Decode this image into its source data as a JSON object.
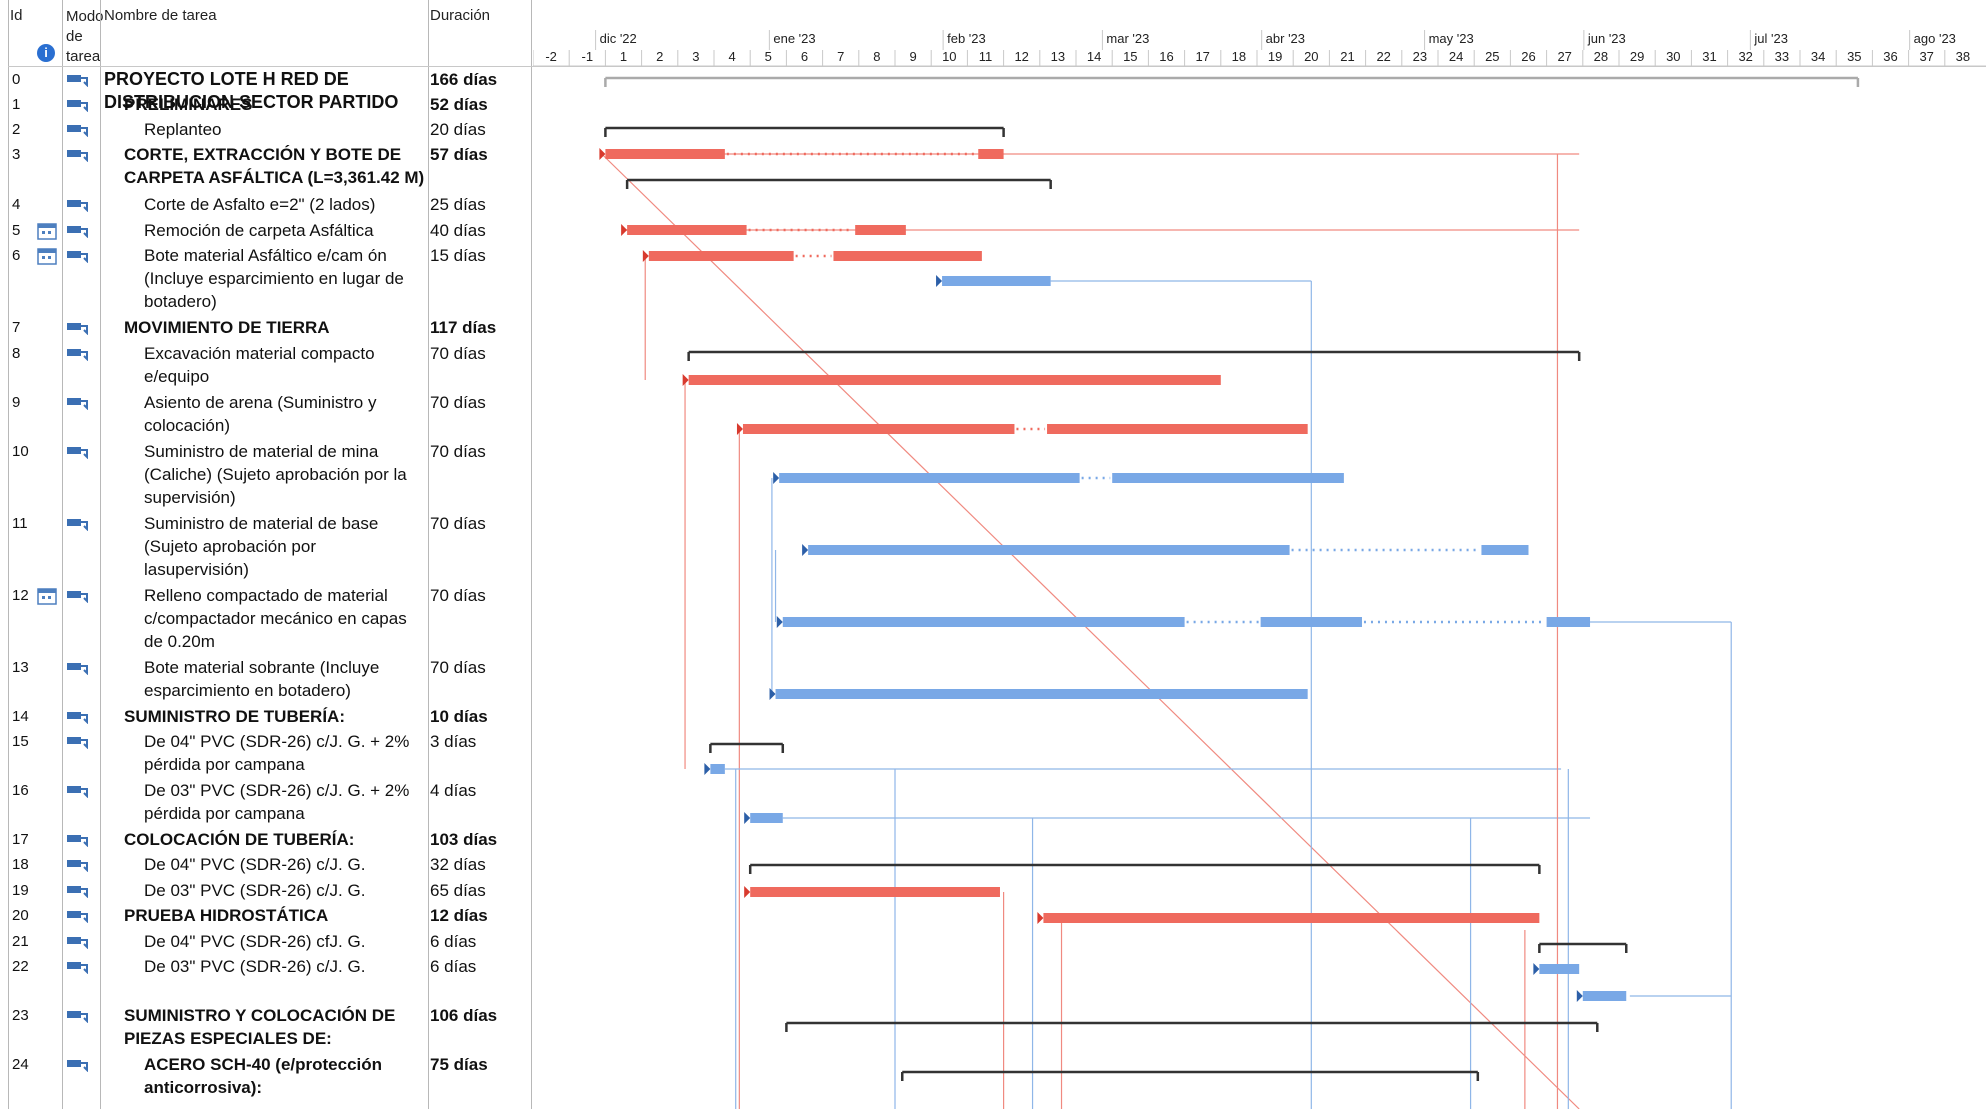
{
  "columns": {
    "id": "Id",
    "mode": "Modo de tarea",
    "name": "Nombre de tarea",
    "duration": "Duración"
  },
  "timescale": {
    "months": [
      "dic '22",
      "ene '23",
      "feb '23",
      "mar '23",
      "abr '23",
      "may '23",
      "jun '23",
      "jul '23",
      "ago '23"
    ],
    "weeks": [
      "-2",
      "-1",
      "1",
      "2",
      "3",
      "4",
      "5",
      "6",
      "7",
      "8",
      "9",
      "10",
      "11",
      "12",
      "13",
      "14",
      "15",
      "16",
      "17",
      "18",
      "19",
      "20",
      "21",
      "22",
      "23",
      "24",
      "25",
      "26",
      "27",
      "28",
      "29",
      "30",
      "31",
      "32",
      "33",
      "34",
      "35",
      "36",
      "37",
      "38"
    ]
  },
  "tasks": [
    {
      "id": "0",
      "name": "PROYECTO LOTE H RED DE DISTRIBUCION SECTOR PARTIDO",
      "duration": "166 días",
      "level": 0,
      "summary": true,
      "calendar": false,
      "segments": [
        [
          1,
          35.6
        ]
      ],
      "critical": false
    },
    {
      "id": "1",
      "name": "PRELIMINARES",
      "duration": "52 días",
      "level": 1,
      "summary": true,
      "calendar": false,
      "segments": [
        [
          1,
          12
        ]
      ],
      "critical": false
    },
    {
      "id": "2",
      "name": "Replanteo",
      "duration": "20 días",
      "level": 2,
      "summary": false,
      "calendar": false,
      "segments": [
        [
          1,
          4.3
        ],
        [
          11.3,
          12
        ]
      ],
      "critical": true
    },
    {
      "id": "3",
      "name": "CORTE, EXTRACCIÓN Y BOTE DE CARPETA ASFÁLTICA (L=3,361.42 M)",
      "duration": "57 días",
      "level": 1,
      "summary": true,
      "calendar": false,
      "segments": [
        [
          1.6,
          13.3
        ]
      ],
      "critical": false
    },
    {
      "id": "4",
      "name": "Corte de Asfalto e=2\" (2 lados)",
      "duration": "25 días",
      "level": 2,
      "summary": false,
      "calendar": false,
      "segments": [
        [
          1.6,
          4.9
        ],
        [
          7.9,
          9.3
        ]
      ],
      "critical": true
    },
    {
      "id": "5",
      "name": "Remoción de carpeta Asfáltica",
      "duration": "40 días",
      "level": 2,
      "summary": false,
      "calendar": true,
      "segments": [
        [
          2.2,
          6.2
        ],
        [
          7.3,
          11.4
        ]
      ],
      "critical": true
    },
    {
      "id": "6",
      "name": "Bote material Asfáltico e/cam ón (Incluye esparcimiento en lugar de botadero)",
      "duration": "15 días",
      "level": 2,
      "summary": false,
      "calendar": true,
      "segments": [
        [
          10.3,
          13.3
        ]
      ],
      "critical": false
    },
    {
      "id": "7",
      "name": "MOVIMIENTO DE TIERRA",
      "duration": "117 días",
      "level": 1,
      "summary": true,
      "calendar": false,
      "segments": [
        [
          3.3,
          27.9
        ]
      ],
      "critical": false
    },
    {
      "id": "8",
      "name": "Excavación material compacto e/equipo",
      "duration": "70 días",
      "level": 2,
      "summary": false,
      "calendar": false,
      "segments": [
        [
          3.3,
          18
        ]
      ],
      "critical": true
    },
    {
      "id": "9",
      "name": "Asiento de arena (Suministro y colocación)",
      "duration": "70 días",
      "level": 2,
      "summary": false,
      "calendar": false,
      "segments": [
        [
          4.8,
          12.3
        ],
        [
          13.2,
          20.4
        ]
      ],
      "critical": true
    },
    {
      "id": "10",
      "name": "Suministro de material de mina (Caliche) (Sujeto aprobación por la supervisión)",
      "duration": "70 días",
      "level": 2,
      "summary": false,
      "calendar": false,
      "segments": [
        [
          5.8,
          14.1
        ],
        [
          15,
          21.4
        ]
      ],
      "critical": false
    },
    {
      "id": "11",
      "name": "Suministro de material de base (Sujeto aprobación por lasupervisión)",
      "duration": "70 días",
      "level": 2,
      "summary": false,
      "calendar": false,
      "segments": [
        [
          6.6,
          19.9
        ],
        [
          25.2,
          26.5
        ]
      ],
      "critical": false
    },
    {
      "id": "12",
      "name": "Relleno compactado de material c/compactador mecánico en capas de 0.20m",
      "duration": "70 días",
      "level": 2,
      "summary": false,
      "calendar": true,
      "segments": [
        [
          5.9,
          17
        ],
        [
          19.1,
          21.9
        ],
        [
          27,
          28.2
        ]
      ],
      "critical": false
    },
    {
      "id": "13",
      "name": "Bote material sobrante (Incluye esparcimiento en botadero)",
      "duration": "70 días",
      "level": 2,
      "summary": false,
      "calendar": false,
      "segments": [
        [
          5.7,
          20.4
        ]
      ],
      "critical": false
    },
    {
      "id": "14",
      "name": "SUMINISTRO DE TUBERÍA:",
      "duration": "10 días",
      "level": 1,
      "summary": true,
      "calendar": false,
      "segments": [
        [
          3.9,
          5.9
        ]
      ],
      "critical": false
    },
    {
      "id": "15",
      "name": "De 04\" PVC (SDR-26) c/J. G. + 2% pérdida por campana",
      "duration": "3 días",
      "level": 2,
      "summary": false,
      "calendar": false,
      "segments": [
        [
          3.9,
          4.3
        ]
      ],
      "critical": false
    },
    {
      "id": "16",
      "name": "De 03\" PVC (SDR-26) c/J. G. + 2% pérdida por campana",
      "duration": "4 días",
      "level": 2,
      "summary": false,
      "calendar": false,
      "segments": [
        [
          5.0,
          5.9
        ]
      ],
      "critical": false
    },
    {
      "id": "17",
      "name": "COLOCACIÓN DE TUBERÍA:",
      "duration": "103 días",
      "level": 1,
      "summary": true,
      "calendar": false,
      "segments": [
        [
          5.0,
          26.8
        ]
      ],
      "critical": false
    },
    {
      "id": "18",
      "name": "De 04\" PVC (SDR-26) c/J. G.",
      "duration": "32 días",
      "level": 2,
      "summary": false,
      "calendar": false,
      "segments": [
        [
          5.0,
          11.9
        ]
      ],
      "critical": true
    },
    {
      "id": "19",
      "name": "De 03\" PVC (SDR-26) c/J. G.",
      "duration": "65 días",
      "level": 2,
      "summary": false,
      "calendar": false,
      "segments": [
        [
          13.1,
          26.8
        ]
      ],
      "critical": true
    },
    {
      "id": "20",
      "name": "PRUEBA HIDROSTÁTICA",
      "duration": "12 días",
      "level": 1,
      "summary": true,
      "calendar": false,
      "segments": [
        [
          26.8,
          29.2
        ]
      ],
      "critical": false
    },
    {
      "id": "21",
      "name": "De 04\" PVC (SDR-26) cfJ. G.",
      "duration": "6 días",
      "level": 2,
      "summary": false,
      "calendar": false,
      "segments": [
        [
          26.8,
          27.9
        ]
      ],
      "critical": false
    },
    {
      "id": "22",
      "name": "De 03\" PVC (SDR-26) c/J. G.",
      "duration": "6 días",
      "level": 2,
      "summary": false,
      "calendar": false,
      "segments": [
        [
          28.0,
          29.2
        ]
      ],
      "critical": false
    },
    {
      "id": "23",
      "name": "SUMINISTRO Y COLOCACIÓN DE PIEZAS ESPECIALES DE:",
      "duration": "106 días",
      "level": 1,
      "summary": true,
      "calendar": false,
      "segments": [
        [
          6.0,
          28.4
        ]
      ],
      "critical": false
    },
    {
      "id": "24",
      "name": "ACERO SCH-40 (e/protección anticorrosiva):",
      "duration": "75 días",
      "level": 2,
      "summary": true,
      "calendar": false,
      "segments": [
        [
          9.2,
          25.1
        ]
      ],
      "critical": false
    }
  ],
  "colors": {
    "critical": "#ef6a5e",
    "normal": "#79a8e6",
    "summary": "#333333",
    "link_critical": "#f08a80",
    "link_normal": "#8fb6e8"
  }
}
